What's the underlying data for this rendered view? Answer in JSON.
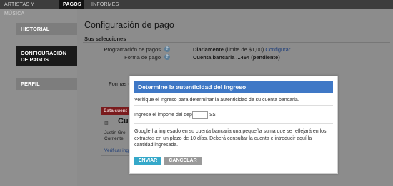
{
  "top_tabs": [
    {
      "label": "ARTISTAS Y MÚSICA",
      "active": false
    },
    {
      "label": "PAGOS",
      "active": true
    },
    {
      "label": "INFORMES",
      "active": false
    }
  ],
  "sidebar": {
    "items": [
      {
        "label": "HISTORIAL",
        "active": false
      },
      {
        "label": "CONFIGURACIÓN DE PAGOS",
        "active": true
      },
      {
        "label": "PERFIL",
        "active": false
      }
    ]
  },
  "page": {
    "title": "Configuración de pago",
    "selections_title": "Sus selecciones",
    "schedule_label": "Programación de pagos",
    "schedule_value": "Diariamente",
    "schedule_note": "(límite de $1,00)",
    "configure_link": "Configurar",
    "method_label": "Forma de pago",
    "method_value": "Cuenta bancaria ...464 (pendiente)",
    "other_methods_label": "Formas d",
    "red_section_label": "Esta cuent",
    "bg_heading": "Cue",
    "bg_name": "Justin Gre",
    "bg_type": "Corriente",
    "bg_verify_link": "Verificar ing"
  },
  "dialog": {
    "title": "Determine la autenticidad del ingreso",
    "intro": "Verifique el ingreso para determinar la autenticidad de su cuenta bancaria.",
    "amount_label": "Ingrese el importe del dep",
    "amount_value": "",
    "currency": "S$",
    "explanation": "Google ha ingresado en su cuenta bancaria una pequeña suma que se reflejará en los extractos en un plazo de 10 días. Deberá consultar la cuenta e introducir aquí la cantidad ingresada.",
    "confirm_label": "ENVIAR",
    "cancel_label": "CANCELAR"
  },
  "colors": {
    "dialog_header": "#3f78c6",
    "confirm_button": "#35a8c9",
    "cancel_button": "#9a9a9a",
    "sidebar_active": "#1a1a1a"
  }
}
